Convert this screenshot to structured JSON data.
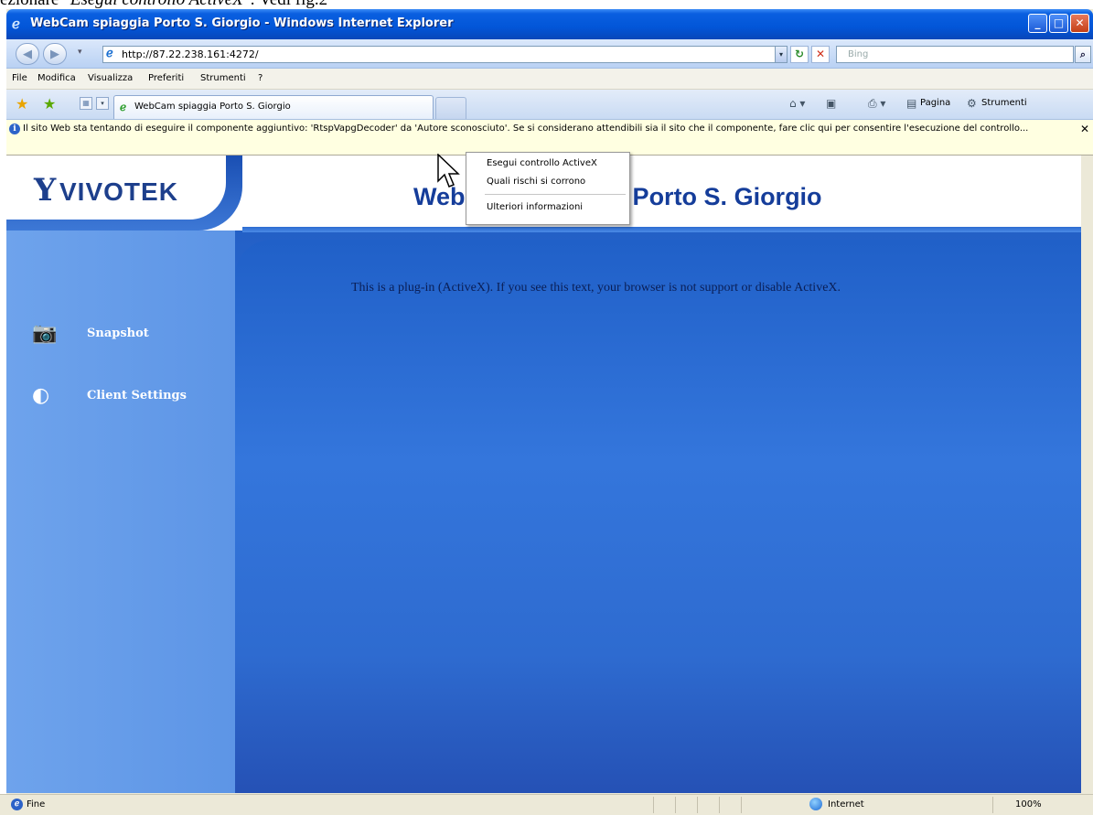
{
  "caption": {
    "plain": "ezionare \"",
    "italic": "Esegui controllo ActiveX",
    "tail": "\": Vedi fig.2"
  },
  "window": {
    "title": "WebCam spiaggia Porto S. Giorgio - Windows Internet Explorer",
    "controls": {
      "minimize": "_",
      "maximize": "□",
      "close": "✕"
    }
  },
  "address_bar": {
    "url": "http://87.22.238.161:4272/",
    "search_placeholder": "Bing"
  },
  "menu": [
    "File",
    "Modifica",
    "Visualizza",
    "Preferiti",
    "Strumenti",
    "?"
  ],
  "tab": {
    "label": "WebCam spiaggia Porto S. Giorgio"
  },
  "command_bar": {
    "page": "Pagina",
    "tools": "Strumenti"
  },
  "info_bar": {
    "text": "Il sito Web sta tentando di eseguire il componente aggiuntivo: 'RtspVapgDecoder' da 'Autore sconosciuto'. Se si considerano attendibili sia il sito che il componente, fare clic qui per consentire l'esecuzione del controllo..."
  },
  "context_menu": {
    "items": [
      "Esegui controllo ActiveX",
      "Quali rischi si corrono",
      "Ulteriori informazioni"
    ]
  },
  "page": {
    "logo": "VIVOTEK",
    "title": "WebCam spiaggia Porto S. Giorgio",
    "activex_message": "This is a plug-in (ActiveX). If you see this text, your browser is not support or disable ActiveX.",
    "nav": [
      "Snapshot",
      "Client Settings"
    ]
  },
  "status_bar": {
    "status": "Fine",
    "zone": "Internet",
    "zoom": "100%"
  },
  "colors": {
    "title_bar": "#0256d8",
    "page_background": "#2f72d9",
    "info_bar": "#ffffe1"
  }
}
